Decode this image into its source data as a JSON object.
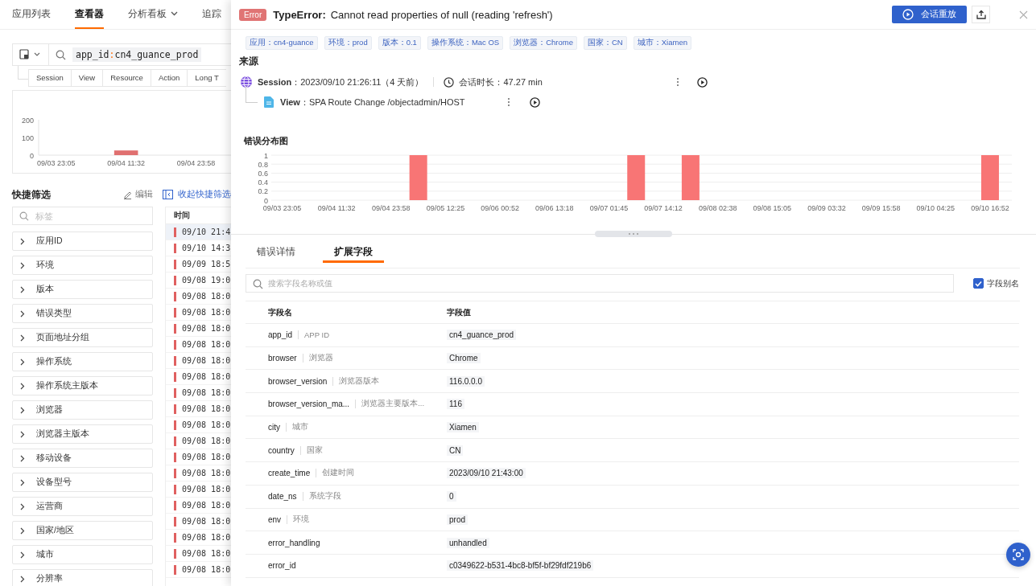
{
  "nav": {
    "tabs": [
      {
        "label": "应用列表",
        "selected": false,
        "dropdown": false
      },
      {
        "label": "查看器",
        "selected": true,
        "dropdown": false
      },
      {
        "label": "分析看板",
        "selected": false,
        "dropdown": true
      },
      {
        "label": "追踪",
        "selected": false,
        "dropdown": false
      }
    ]
  },
  "query": {
    "key": "app_id",
    "separator": ":",
    "value": "cn4_guance_prod"
  },
  "data_types": [
    "Session",
    "View",
    "Resource",
    "Action",
    "Long T"
  ],
  "overview": {
    "chart_data": {
      "type": "bar",
      "categories": [
        "09/03 23:05",
        null,
        "09/04 11:32",
        null,
        "09/04 23:58",
        null
      ],
      "values": [
        null,
        null,
        22,
        0,
        0,
        null
      ],
      "ylim": [
        0,
        200
      ],
      "yticks": [
        0,
        100,
        200
      ]
    }
  },
  "quick_filter": {
    "title": "快捷筛选",
    "edit": "编辑",
    "collapse": "收起快捷筛选",
    "placeholder": "标签",
    "items": [
      "应用ID",
      "环境",
      "版本",
      "错误类型",
      "页面地址分组",
      "操作系统",
      "操作系统主版本",
      "浏览器",
      "浏览器主版本",
      "移动设备",
      "设备型号",
      "运营商",
      "国家/地区",
      "城市",
      "分辨率"
    ]
  },
  "events": {
    "column": "时间",
    "rows": [
      {
        "time": "09/10 21:4",
        "selected": true
      },
      {
        "time": "09/10 14:3",
        "selected": false
      },
      {
        "time": "09/09 18:5",
        "selected": false
      },
      {
        "time": "09/08 19:0",
        "selected": false
      },
      {
        "time": "09/08 18:0",
        "selected": false
      },
      {
        "time": "09/08 18:0",
        "selected": false
      },
      {
        "time": "09/08 18:0",
        "selected": false
      },
      {
        "time": "09/08 18:0",
        "selected": false
      },
      {
        "time": "09/08 18:0",
        "selected": false
      },
      {
        "time": "09/08 18:0",
        "selected": false
      },
      {
        "time": "09/08 18:0",
        "selected": false
      },
      {
        "time": "09/08 18:0",
        "selected": false
      },
      {
        "time": "09/08 18:0",
        "selected": false
      },
      {
        "time": "09/08 18:0",
        "selected": false
      },
      {
        "time": "09/08 18:0",
        "selected": false
      },
      {
        "time": "09/08 18:0",
        "selected": false
      },
      {
        "time": "09/08 18:0",
        "selected": false
      },
      {
        "time": "09/08 18:0",
        "selected": false
      },
      {
        "time": "09/08 18:0",
        "selected": false
      },
      {
        "time": "09/08 18:0",
        "selected": false
      },
      {
        "time": "09/08 18:0",
        "selected": false
      },
      {
        "time": "09/08 18:0",
        "selected": false
      }
    ]
  },
  "drawer": {
    "error": {
      "badge": "Error",
      "type": "TypeError:",
      "message": "Cannot read properties of null (reading 'refresh')"
    },
    "replay_button": "会话重放",
    "tags": [
      "应用：cn4-guance",
      "环境：prod",
      "版本：0.1",
      "操作系统：Mac OS",
      "浏览器：Chrome",
      "国家：CN",
      "城市：Xiamen"
    ],
    "source": {
      "title": "来源",
      "session": "**Session**：2023/09/10 21:26:11（4 天前）",
      "duration": "会话时长：47.27 min",
      "view": "**View**：SPA Route Change /objectadmin/HOST"
    },
    "distribution": {
      "title": "错误分布图",
      "chart_data": {
        "type": "bar",
        "grid": true,
        "ylim": [
          0,
          1
        ],
        "yticks": [
          0,
          0.2,
          0.4,
          0.6,
          0.8,
          1
        ],
        "categories": [
          "09/03 23:05",
          null,
          "09/04 11:32",
          null,
          "09/04 23:58",
          null,
          "09/05 12:25",
          null,
          "09/06 00:52",
          null,
          "09/06 13:18",
          null,
          "09/07 01:45",
          null,
          "09/07 14:12",
          null,
          "09/08 02:38",
          null,
          "09/08 15:05",
          null,
          "09/09 03:32",
          null,
          "09/09 15:58",
          null,
          "09/10 04:25",
          null,
          "09/10 16:52",
          null
        ],
        "values": [
          0,
          0,
          0,
          0,
          0,
          1,
          0,
          0,
          0,
          0,
          0,
          0,
          0,
          1,
          0,
          1,
          0,
          0,
          0,
          0,
          0,
          0,
          0,
          0,
          0,
          0,
          1,
          0
        ]
      }
    },
    "detail_tabs": [
      {
        "label": "错误详情",
        "selected": false
      },
      {
        "label": "扩展字段",
        "selected": true
      }
    ],
    "field_search": {
      "placeholder": "搜索字段名称或值"
    },
    "alias_toggle": {
      "label": "字段别名",
      "checked": true
    },
    "fields": {
      "columns": [
        "字段名",
        "字段值"
      ],
      "rows": [
        {
          "name": "app_id",
          "alias": "APP ID",
          "value": "cn4_guance_prod"
        },
        {
          "name": "browser",
          "alias": "浏览器",
          "value": "Chrome"
        },
        {
          "name": "browser_version",
          "alias": "浏览器版本",
          "value": "116.0.0.0"
        },
        {
          "name": "browser_version_ma...",
          "alias": "浏览器主要版本...",
          "value": "116"
        },
        {
          "name": "city",
          "alias": "城市",
          "value": "Xiamen"
        },
        {
          "name": "country",
          "alias": "国家",
          "value": "CN"
        },
        {
          "name": "create_time",
          "alias": "创建时间",
          "value": "2023/09/10 21:43:00"
        },
        {
          "name": "date_ns",
          "alias": "系统字段",
          "value": "0"
        },
        {
          "name": "env",
          "alias": "环境",
          "value": "prod"
        },
        {
          "name": "error_handling",
          "value": "unhandled"
        },
        {
          "name": "error_id",
          "value": "c0349622-b531-4bc8-bf5f-bf29fdf219b6"
        }
      ]
    }
  }
}
